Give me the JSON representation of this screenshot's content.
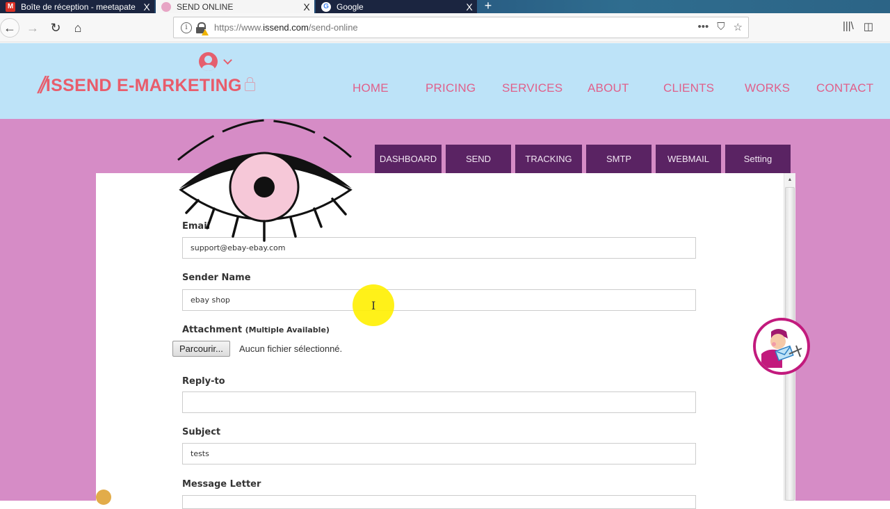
{
  "browser": {
    "tabs": [
      {
        "title": "Boîte de réception - meetapate",
        "icon": "gmail-icon",
        "active": false
      },
      {
        "title": "SEND ONLINE",
        "icon": "issend-favicon",
        "active": true
      },
      {
        "title": "Google",
        "icon": "google-icon",
        "active": false
      }
    ],
    "new_tab": "+",
    "close_glyph": "X",
    "url_prefix": "https://www.",
    "url_domain": "issend.com",
    "url_path": "/send-online",
    "nav": {
      "back": "←",
      "forward": "→",
      "reload": "↻",
      "home": "⌂"
    },
    "url_actions": {
      "more": "•••",
      "pocket": "⛉",
      "bookmark": "☆"
    },
    "toolbar": {
      "library": "|||\\",
      "sidebar": "◫"
    }
  },
  "site": {
    "logo_slash": "//",
    "logo_text": "ISSEND E-MARKETING",
    "nav": [
      "HOME",
      "PRICING",
      "SERVICES",
      "ABOUT",
      "CLIENTS",
      "WORKS",
      "CONTACT"
    ],
    "colors": {
      "header_bg": "#bde3f8",
      "brand": "#e85c6b",
      "nav_link": "#e0608a",
      "page_bg": "#d68cc6",
      "app_tab": "#5a2363"
    }
  },
  "app_tabs": [
    "DASHBOARD",
    "SEND",
    "TRACKING",
    "SMTP",
    "WEBMAIL",
    "Setting"
  ],
  "form": {
    "email": {
      "label": "Email",
      "value": "support@ebay-ebay.com"
    },
    "sender_name": {
      "label": "Sender Name",
      "value": "ebay shop"
    },
    "attachment": {
      "label": "Attachment",
      "sublabel": "(Multiple Available)",
      "button": "Parcourir...",
      "status": "Aucun fichier sélectionné."
    },
    "reply_to": {
      "label": "Reply-to",
      "value": ""
    },
    "subject": {
      "label": "Subject",
      "value": "tests"
    },
    "message": {
      "label": "Message Letter"
    }
  },
  "scrollbar": {
    "up_arrow": "▲"
  }
}
